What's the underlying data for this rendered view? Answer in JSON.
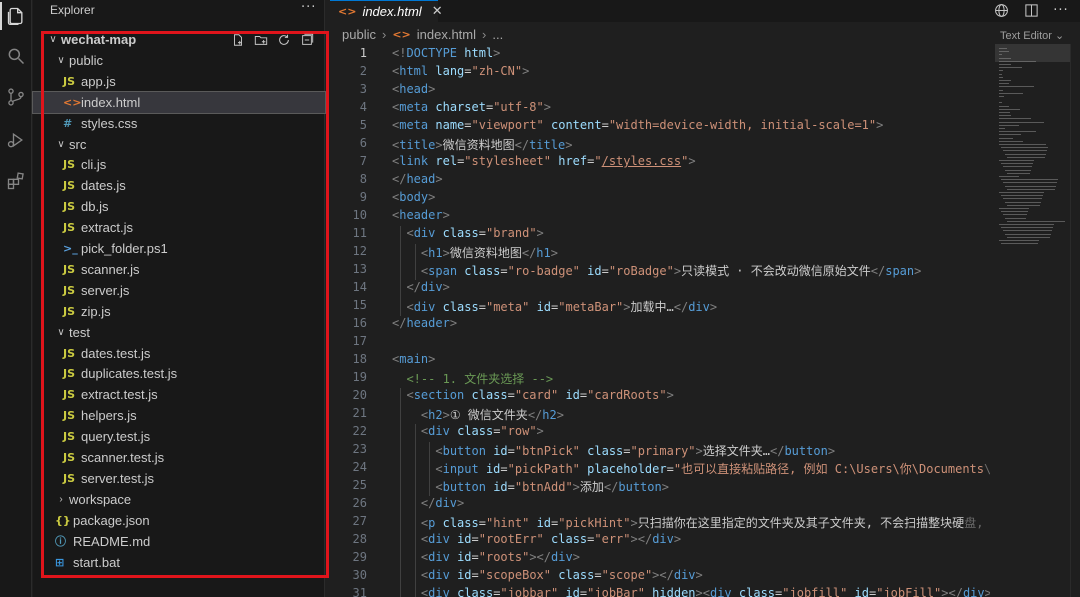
{
  "sidebar": {
    "title": "Explorer",
    "more": "···",
    "root": "wechat-map",
    "items": [
      {
        "label": "wechat-map",
        "kind": "folder-open",
        "depth": 0,
        "name": "tree-root-wechat-map"
      },
      {
        "label": "public",
        "kind": "folder-open",
        "depth": 1,
        "name": "tree-folder-public"
      },
      {
        "label": "app.js",
        "kind": "js",
        "depth": 2,
        "name": "tree-file-app-js"
      },
      {
        "label": "index.html",
        "kind": "html",
        "depth": 2,
        "name": "tree-file-index-html",
        "selected": true
      },
      {
        "label": "styles.css",
        "kind": "css",
        "depth": 2,
        "name": "tree-file-styles-css"
      },
      {
        "label": "src",
        "kind": "folder-open",
        "depth": 1,
        "name": "tree-folder-src"
      },
      {
        "label": "cli.js",
        "kind": "js",
        "depth": 2,
        "name": "tree-file-cli-js"
      },
      {
        "label": "dates.js",
        "kind": "js",
        "depth": 2,
        "name": "tree-file-dates-js"
      },
      {
        "label": "db.js",
        "kind": "js",
        "depth": 2,
        "name": "tree-file-db-js"
      },
      {
        "label": "extract.js",
        "kind": "js",
        "depth": 2,
        "name": "tree-file-extract-js"
      },
      {
        "label": "pick_folder.ps1",
        "kind": "ps",
        "depth": 2,
        "name": "tree-file-pick-folder-ps1"
      },
      {
        "label": "scanner.js",
        "kind": "js",
        "depth": 2,
        "name": "tree-file-scanner-js"
      },
      {
        "label": "server.js",
        "kind": "js",
        "depth": 2,
        "name": "tree-file-server-js"
      },
      {
        "label": "zip.js",
        "kind": "js",
        "depth": 2,
        "name": "tree-file-zip-js"
      },
      {
        "label": "test",
        "kind": "folder-open",
        "depth": 1,
        "name": "tree-folder-test"
      },
      {
        "label": "dates.test.js",
        "kind": "js",
        "depth": 2,
        "name": "tree-file-dates-test-js"
      },
      {
        "label": "duplicates.test.js",
        "kind": "js",
        "depth": 2,
        "name": "tree-file-duplicates-test-js"
      },
      {
        "label": "extract.test.js",
        "kind": "js",
        "depth": 2,
        "name": "tree-file-extract-test-js"
      },
      {
        "label": "helpers.js",
        "kind": "js",
        "depth": 2,
        "name": "tree-file-helpers-js"
      },
      {
        "label": "query.test.js",
        "kind": "js",
        "depth": 2,
        "name": "tree-file-query-test-js"
      },
      {
        "label": "scanner.test.js",
        "kind": "js",
        "depth": 2,
        "name": "tree-file-scanner-test-js"
      },
      {
        "label": "server.test.js",
        "kind": "js",
        "depth": 2,
        "name": "tree-file-server-test-js"
      },
      {
        "label": "workspace",
        "kind": "folder-closed",
        "depth": 1,
        "name": "tree-folder-workspace"
      },
      {
        "label": "package.json",
        "kind": "json",
        "depth": 1,
        "name": "tree-file-package-json"
      },
      {
        "label": "README.md",
        "kind": "info",
        "depth": 1,
        "name": "tree-file-readme-md"
      },
      {
        "label": "start.bat",
        "kind": "win",
        "depth": 1,
        "name": "tree-file-start-bat"
      }
    ]
  },
  "tab": {
    "label": "index.html",
    "icon": "<>",
    "close": "✕"
  },
  "tab_more": "···",
  "breadcrumb": {
    "folder": "public",
    "file": "index.html",
    "tail": "..."
  },
  "text_editor_label": "Text Editor ⌄",
  "colors": {
    "highlight_box": "#e0141b",
    "selected_row": "#37373d",
    "accent": "#0078d4"
  },
  "icons": {
    "activity": [
      "files-icon",
      "search-icon",
      "source-control-icon",
      "run-debug-icon",
      "extensions-icon"
    ],
    "root_actions": [
      "new-file-icon",
      "new-folder-icon",
      "refresh-icon",
      "collapse-all-icon"
    ],
    "tab_actions": [
      "globe-icon",
      "split-editor-icon",
      "more-actions-icon"
    ]
  },
  "editor": {
    "line_numbers": [
      "1",
      "2",
      "3",
      "4",
      "5",
      "6",
      "7",
      "8",
      "9",
      "10",
      "11",
      "12",
      "13",
      "14",
      "15",
      "16",
      "17",
      "18",
      "19",
      "20",
      "21",
      "22",
      "23",
      "24",
      "25",
      "26",
      "27",
      "28",
      "29",
      "30",
      "31"
    ],
    "lines": [
      [
        [
          "p",
          "<!"
        ],
        [
          "t",
          "DOCTYPE"
        ],
        [
          "x",
          " "
        ],
        [
          "a",
          "html"
        ],
        [
          "p",
          ">"
        ]
      ],
      [
        [
          "p",
          "<"
        ],
        [
          "t",
          "html"
        ],
        [
          "x",
          " "
        ],
        [
          "a",
          "lang"
        ],
        [
          "x",
          "="
        ],
        [
          "s",
          "\"zh-CN\""
        ],
        [
          "p",
          ">"
        ]
      ],
      [
        [
          "p",
          "<"
        ],
        [
          "t",
          "head"
        ],
        [
          "p",
          ">"
        ]
      ],
      [
        [
          "p",
          "<"
        ],
        [
          "t",
          "meta"
        ],
        [
          "x",
          " "
        ],
        [
          "a",
          "charset"
        ],
        [
          "x",
          "="
        ],
        [
          "s",
          "\"utf-8\""
        ],
        [
          "p",
          ">"
        ]
      ],
      [
        [
          "p",
          "<"
        ],
        [
          "t",
          "meta"
        ],
        [
          "x",
          " "
        ],
        [
          "a",
          "name"
        ],
        [
          "x",
          "="
        ],
        [
          "s",
          "\"viewport\""
        ],
        [
          "x",
          " "
        ],
        [
          "a",
          "content"
        ],
        [
          "x",
          "="
        ],
        [
          "s",
          "\"width=device-width, initial-scale=1\""
        ],
        [
          "p",
          ">"
        ]
      ],
      [
        [
          "p",
          "<"
        ],
        [
          "t",
          "title"
        ],
        [
          "p",
          ">"
        ],
        [
          "x",
          "微信资料地图"
        ],
        [
          "p",
          "</"
        ],
        [
          "t",
          "title"
        ],
        [
          "p",
          ">"
        ]
      ],
      [
        [
          "p",
          "<"
        ],
        [
          "t",
          "link"
        ],
        [
          "x",
          " "
        ],
        [
          "a",
          "rel"
        ],
        [
          "x",
          "="
        ],
        [
          "s",
          "\"stylesheet\""
        ],
        [
          "x",
          " "
        ],
        [
          "a",
          "href"
        ],
        [
          "x",
          "="
        ],
        [
          "s",
          "\""
        ],
        [
          "lnk",
          "/styles.css"
        ],
        [
          "s",
          "\""
        ],
        [
          "p",
          ">"
        ]
      ],
      [
        [
          "p",
          "</"
        ],
        [
          "t",
          "head"
        ],
        [
          "p",
          ">"
        ]
      ],
      [
        [
          "p",
          "<"
        ],
        [
          "t",
          "body"
        ],
        [
          "p",
          ">"
        ]
      ],
      [
        [
          "p",
          "<"
        ],
        [
          "t",
          "header"
        ],
        [
          "p",
          ">"
        ]
      ],
      [
        [
          "x",
          "  "
        ],
        [
          "p",
          "<"
        ],
        [
          "t",
          "div"
        ],
        [
          "x",
          " "
        ],
        [
          "a",
          "class"
        ],
        [
          "x",
          "="
        ],
        [
          "s",
          "\"brand\""
        ],
        [
          "p",
          ">"
        ]
      ],
      [
        [
          "x",
          "    "
        ],
        [
          "p",
          "<"
        ],
        [
          "t",
          "h1"
        ],
        [
          "p",
          ">"
        ],
        [
          "x",
          "微信资料地图"
        ],
        [
          "p",
          "</"
        ],
        [
          "t",
          "h1"
        ],
        [
          "p",
          ">"
        ]
      ],
      [
        [
          "x",
          "    "
        ],
        [
          "p",
          "<"
        ],
        [
          "t",
          "span"
        ],
        [
          "x",
          " "
        ],
        [
          "a",
          "class"
        ],
        [
          "x",
          "="
        ],
        [
          "s",
          "\"ro-badge\""
        ],
        [
          "x",
          " "
        ],
        [
          "a",
          "id"
        ],
        [
          "x",
          "="
        ],
        [
          "s",
          "\"roBadge\""
        ],
        [
          "p",
          ">"
        ],
        [
          "x",
          "只读模式 · 不会改动微信原始文件"
        ],
        [
          "p",
          "</"
        ],
        [
          "t",
          "span"
        ],
        [
          "p",
          ">"
        ]
      ],
      [
        [
          "x",
          "  "
        ],
        [
          "p",
          "</"
        ],
        [
          "t",
          "div"
        ],
        [
          "p",
          ">"
        ]
      ],
      [
        [
          "x",
          "  "
        ],
        [
          "p",
          "<"
        ],
        [
          "t",
          "div"
        ],
        [
          "x",
          " "
        ],
        [
          "a",
          "class"
        ],
        [
          "x",
          "="
        ],
        [
          "s",
          "\"meta\""
        ],
        [
          "x",
          " "
        ],
        [
          "a",
          "id"
        ],
        [
          "x",
          "="
        ],
        [
          "s",
          "\"metaBar\""
        ],
        [
          "p",
          ">"
        ],
        [
          "x",
          "加载中…"
        ],
        [
          "p",
          "</"
        ],
        [
          "t",
          "div"
        ],
        [
          "p",
          ">"
        ]
      ],
      [
        [
          "p",
          "</"
        ],
        [
          "t",
          "header"
        ],
        [
          "p",
          ">"
        ]
      ],
      [],
      [
        [
          "p",
          "<"
        ],
        [
          "t",
          "main"
        ],
        [
          "p",
          ">"
        ]
      ],
      [
        [
          "x",
          "  "
        ],
        [
          "c",
          "<!-- 1. 文件夹选择 -->"
        ]
      ],
      [
        [
          "x",
          "  "
        ],
        [
          "p",
          "<"
        ],
        [
          "t",
          "section"
        ],
        [
          "x",
          " "
        ],
        [
          "a",
          "class"
        ],
        [
          "x",
          "="
        ],
        [
          "s",
          "\"card\""
        ],
        [
          "x",
          " "
        ],
        [
          "a",
          "id"
        ],
        [
          "x",
          "="
        ],
        [
          "s",
          "\"cardRoots\""
        ],
        [
          "p",
          ">"
        ]
      ],
      [
        [
          "x",
          "    "
        ],
        [
          "p",
          "<"
        ],
        [
          "t",
          "h2"
        ],
        [
          "p",
          ">"
        ],
        [
          "x",
          "① 微信文件夹"
        ],
        [
          "p",
          "</"
        ],
        [
          "t",
          "h2"
        ],
        [
          "p",
          ">"
        ]
      ],
      [
        [
          "x",
          "    "
        ],
        [
          "p",
          "<"
        ],
        [
          "t",
          "div"
        ],
        [
          "x",
          " "
        ],
        [
          "a",
          "class"
        ],
        [
          "x",
          "="
        ],
        [
          "s",
          "\"row\""
        ],
        [
          "p",
          ">"
        ]
      ],
      [
        [
          "x",
          "      "
        ],
        [
          "p",
          "<"
        ],
        [
          "t",
          "button"
        ],
        [
          "x",
          " "
        ],
        [
          "a",
          "id"
        ],
        [
          "x",
          "="
        ],
        [
          "s",
          "\"btnPick\""
        ],
        [
          "x",
          " "
        ],
        [
          "a",
          "class"
        ],
        [
          "x",
          "="
        ],
        [
          "s",
          "\"primary\""
        ],
        [
          "p",
          ">"
        ],
        [
          "x",
          "选择文件夹…"
        ],
        [
          "p",
          "</"
        ],
        [
          "t",
          "button"
        ],
        [
          "p",
          ">"
        ]
      ],
      [
        [
          "x",
          "      "
        ],
        [
          "p",
          "<"
        ],
        [
          "t",
          "input"
        ],
        [
          "x",
          " "
        ],
        [
          "a",
          "id"
        ],
        [
          "x",
          "="
        ],
        [
          "s",
          "\"pickPath\""
        ],
        [
          "x",
          " "
        ],
        [
          "a",
          "placeholder"
        ],
        [
          "x",
          "="
        ],
        [
          "s",
          "\"也可以直接粘贴路径, 例如 C:\\Users\\你\\Documents"
        ],
        [
          "fade",
          "\\xwecha"
        ]
      ],
      [
        [
          "x",
          "      "
        ],
        [
          "p",
          "<"
        ],
        [
          "t",
          "button"
        ],
        [
          "x",
          " "
        ],
        [
          "a",
          "id"
        ],
        [
          "x",
          "="
        ],
        [
          "s",
          "\"btnAdd\""
        ],
        [
          "p",
          ">"
        ],
        [
          "x",
          "添加"
        ],
        [
          "p",
          "</"
        ],
        [
          "t",
          "button"
        ],
        [
          "p",
          ">"
        ]
      ],
      [
        [
          "x",
          "    "
        ],
        [
          "p",
          "</"
        ],
        [
          "t",
          "div"
        ],
        [
          "p",
          ">"
        ]
      ],
      [
        [
          "x",
          "    "
        ],
        [
          "p",
          "<"
        ],
        [
          "t",
          "p"
        ],
        [
          "x",
          " "
        ],
        [
          "a",
          "class"
        ],
        [
          "x",
          "="
        ],
        [
          "s",
          "\"hint\""
        ],
        [
          "x",
          " "
        ],
        [
          "a",
          "id"
        ],
        [
          "x",
          "="
        ],
        [
          "s",
          "\"pickHint\""
        ],
        [
          "p",
          ">"
        ],
        [
          "x",
          "只扫描你在这里指定的文件夹及其子文件夹, 不会扫描整块硬"
        ],
        [
          "fade",
          "盘, 也不"
        ]
      ],
      [
        [
          "x",
          "    "
        ],
        [
          "p",
          "<"
        ],
        [
          "t",
          "div"
        ],
        [
          "x",
          " "
        ],
        [
          "a",
          "id"
        ],
        [
          "x",
          "="
        ],
        [
          "s",
          "\"rootErr\""
        ],
        [
          "x",
          " "
        ],
        [
          "a",
          "class"
        ],
        [
          "x",
          "="
        ],
        [
          "s",
          "\"err\""
        ],
        [
          "p",
          "></"
        ],
        [
          "t",
          "div"
        ],
        [
          "p",
          ">"
        ]
      ],
      [
        [
          "x",
          "    "
        ],
        [
          "p",
          "<"
        ],
        [
          "t",
          "div"
        ],
        [
          "x",
          " "
        ],
        [
          "a",
          "id"
        ],
        [
          "x",
          "="
        ],
        [
          "s",
          "\"roots\""
        ],
        [
          "p",
          "></"
        ],
        [
          "t",
          "div"
        ],
        [
          "p",
          ">"
        ]
      ],
      [
        [
          "x",
          "    "
        ],
        [
          "p",
          "<"
        ],
        [
          "t",
          "div"
        ],
        [
          "x",
          " "
        ],
        [
          "a",
          "id"
        ],
        [
          "x",
          "="
        ],
        [
          "s",
          "\"scopeBox\""
        ],
        [
          "x",
          " "
        ],
        [
          "a",
          "class"
        ],
        [
          "x",
          "="
        ],
        [
          "s",
          "\"scope\""
        ],
        [
          "p",
          "></"
        ],
        [
          "t",
          "div"
        ],
        [
          "p",
          ">"
        ]
      ],
      [
        [
          "x",
          "    "
        ],
        [
          "p",
          "<"
        ],
        [
          "t",
          "div"
        ],
        [
          "x",
          " "
        ],
        [
          "a",
          "class"
        ],
        [
          "x",
          "="
        ],
        [
          "s",
          "\"jobbar\""
        ],
        [
          "x",
          " "
        ],
        [
          "a",
          "id"
        ],
        [
          "x",
          "="
        ],
        [
          "s",
          "\"jobBar\""
        ],
        [
          "x",
          " "
        ],
        [
          "a",
          "hidden"
        ],
        [
          "p",
          "><"
        ],
        [
          "t",
          "div"
        ],
        [
          "x",
          " "
        ],
        [
          "a",
          "class"
        ],
        [
          "x",
          "="
        ],
        [
          "s",
          "\"jobfill\""
        ],
        [
          "x",
          " "
        ],
        [
          "a",
          "id"
        ],
        [
          "x",
          "="
        ],
        [
          "s",
          "\"jobFill\""
        ],
        [
          "p",
          "></"
        ],
        [
          "t",
          "div"
        ],
        [
          "p",
          "></"
        ]
      ]
    ]
  }
}
